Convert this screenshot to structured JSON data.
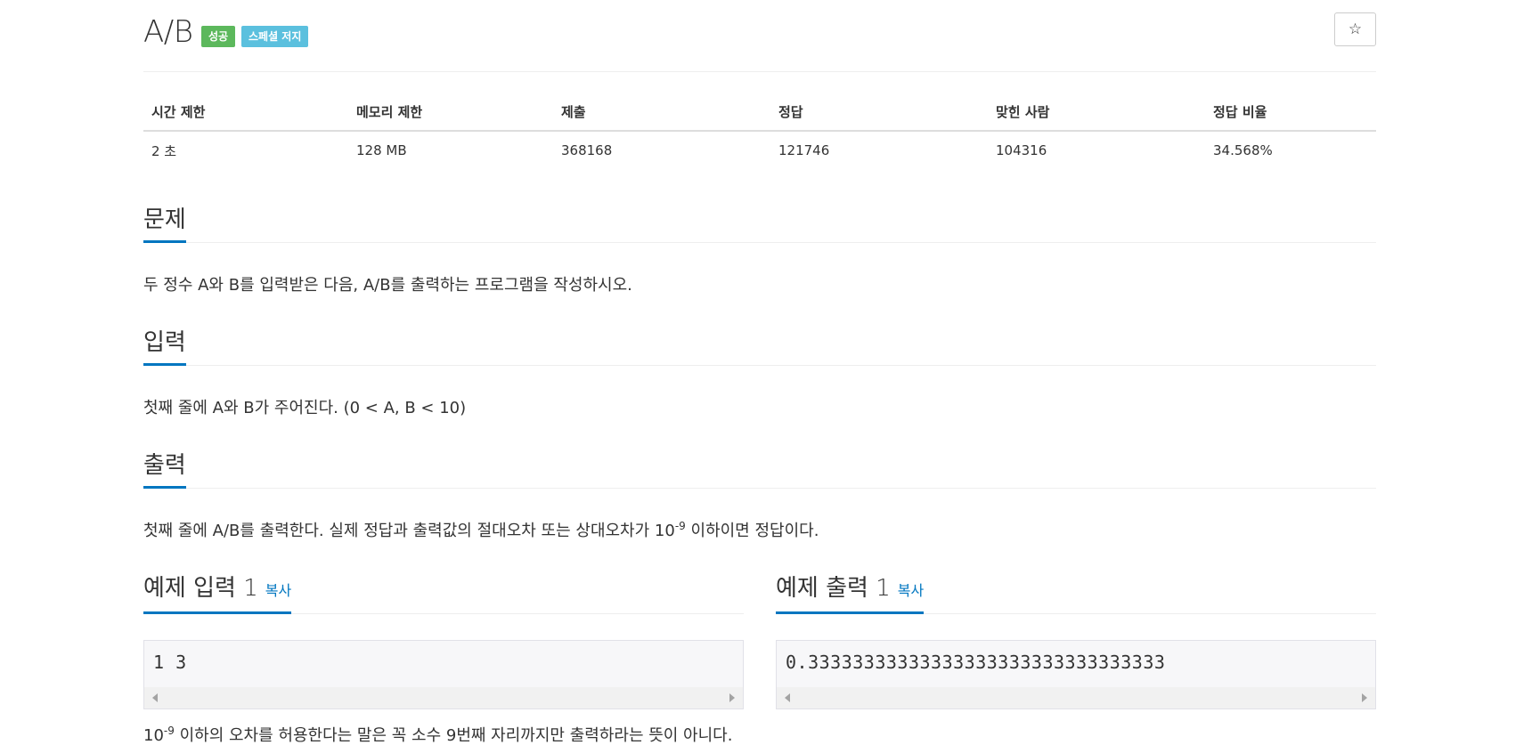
{
  "problem": {
    "title": "A/B",
    "badges": {
      "success": "성공",
      "special": "스페셜 저지"
    },
    "star_icon": "☆"
  },
  "info": {
    "headers": [
      "시간 제한",
      "메모리 제한",
      "제출",
      "정답",
      "맞힌 사람",
      "정답 비율"
    ],
    "values": [
      "2 초",
      "128 MB",
      "368168",
      "121746",
      "104316",
      "34.568%"
    ]
  },
  "sections": {
    "problem": {
      "title": "문제",
      "text": "두 정수 A와 B를 입력받은 다음, A/B를 출력하는 프로그램을 작성하시오."
    },
    "input": {
      "title": "입력",
      "text": "첫째 줄에 A와 B가 주어진다. (0 < A, B < 10)"
    },
    "output": {
      "title": "출력",
      "text_before": "첫째 줄에 A/B를 출력한다. 실제 정답과 출력값의 절대오차 또는 상대오차가 10",
      "exponent": "-9",
      "text_after": " 이하이면 정답이다."
    }
  },
  "samples": {
    "copy_label": "복사",
    "input": {
      "title": "예제 입력 1",
      "code": "1 3"
    },
    "output": {
      "title": "예제 출력 1",
      "code": "0.33333333333333333333333333333333"
    }
  },
  "note": {
    "base": "10",
    "exponent": "-9",
    "text": " 이하의 오차를 허용한다는 말은 꼭 소수 9번째 자리까지만 출력하라는 뜻이 아니다."
  },
  "colors": {
    "accent": "#0076c0",
    "success": "#5cb85c",
    "special": "#5bc0de"
  }
}
